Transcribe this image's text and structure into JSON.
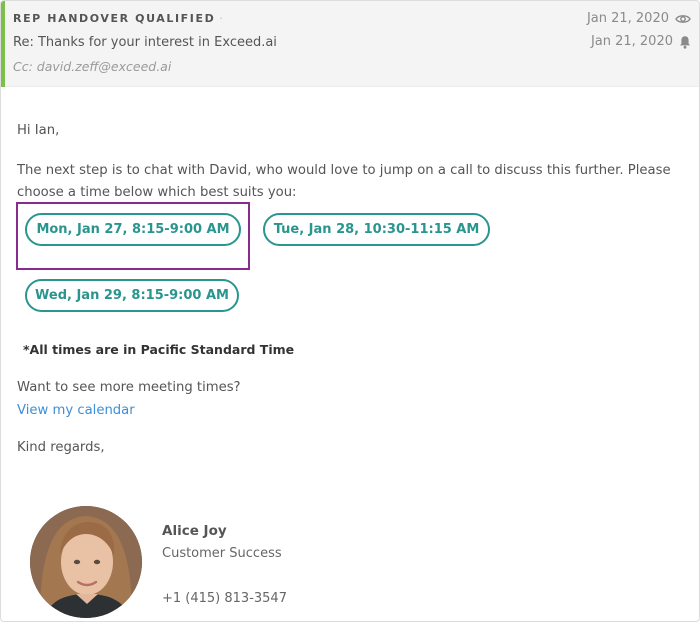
{
  "header": {
    "tag": "REP HANDOVER QUALIFIED",
    "tag_separator": "·",
    "subject": "Re: Thanks for your interest in Exceed.ai",
    "cc": "Cc: david.zeff@exceed.ai",
    "date_viewed": "Jan 21, 2020",
    "date_sent": "Jan 21, 2020",
    "icons": [
      "eye-icon",
      "bell-icon"
    ],
    "accent_color": "#7cc04b"
  },
  "message": {
    "greeting": "Hi Ian,",
    "intro": "The next step is to chat with David, who would love to jump on a call to discuss this further. Please choose a time below which best suits you:",
    "time_slots": [
      "Mon, Jan 27, 8:15-9:00 AM",
      "Tue, Jan 28, 10:30-11:15 AM",
      "Wed, Jan 29, 8:15-9:00 AM"
    ],
    "timezone_note": "*All times are in Pacific Standard Time",
    "more_times_prompt": "Want to see more meeting times?",
    "calendar_link": "View my calendar",
    "closing": "Kind regards,"
  },
  "signature": {
    "name": "Alice Joy",
    "role": "Customer Success",
    "phone": "+1 (415) 813-3547"
  },
  "colors": {
    "slot_accent": "#2a958e",
    "highlight_border": "#8a2c8e",
    "link": "#3d8fd8"
  }
}
